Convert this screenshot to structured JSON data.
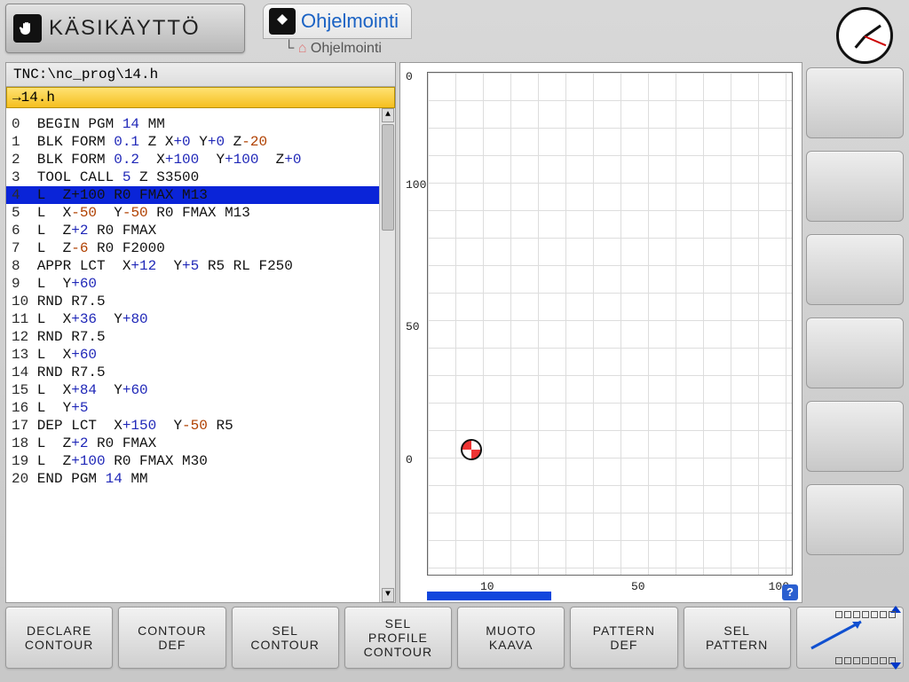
{
  "header": {
    "mode_label": "KÄSIKÄYTTÖ",
    "tab_label": "Ohjelmointi",
    "breadcrumb": "Ohjelmointi"
  },
  "editor": {
    "path": "TNC:\\nc_prog\\14.h",
    "file_tab": "→14.h",
    "selected_index": 4,
    "lines": [
      {
        "n": "0",
        "t": [
          [
            "kw",
            " BEGIN PGM "
          ],
          [
            "num",
            "14"
          ],
          [
            "kw",
            " MM"
          ]
        ]
      },
      {
        "n": "1",
        "t": [
          [
            "kw",
            " BLK FORM "
          ],
          [
            "num",
            "0.1"
          ],
          [
            "kw",
            " Z X"
          ],
          [
            "num",
            "+0"
          ],
          [
            "kw",
            " Y"
          ],
          [
            "num",
            "+0"
          ],
          [
            "kw",
            " Z"
          ],
          [
            "neg",
            "-20"
          ]
        ]
      },
      {
        "n": "2",
        "t": [
          [
            "kw",
            " BLK FORM "
          ],
          [
            "num",
            "0.2"
          ],
          [
            "kw",
            "  X"
          ],
          [
            "num",
            "+100"
          ],
          [
            "kw",
            "  Y"
          ],
          [
            "num",
            "+100"
          ],
          [
            "kw",
            "  Z"
          ],
          [
            "num",
            "+0"
          ]
        ]
      },
      {
        "n": "3",
        "t": [
          [
            "kw",
            " TOOL CALL "
          ],
          [
            "num",
            "5"
          ],
          [
            "kw",
            " Z S3500"
          ]
        ]
      },
      {
        "n": "4",
        "t": [
          [
            "kw",
            " L  Z+100 R0 FMAX M13"
          ]
        ]
      },
      {
        "n": "5",
        "t": [
          [
            "kw",
            " L  X"
          ],
          [
            "neg",
            "-50"
          ],
          [
            "kw",
            "  Y"
          ],
          [
            "neg",
            "-50"
          ],
          [
            "kw",
            " R0 FMAX M13"
          ]
        ]
      },
      {
        "n": "6",
        "t": [
          [
            "kw",
            " L  Z"
          ],
          [
            "num",
            "+2"
          ],
          [
            "kw",
            " R0 FMAX"
          ]
        ]
      },
      {
        "n": "7",
        "t": [
          [
            "kw",
            " L  Z"
          ],
          [
            "neg",
            "-6"
          ],
          [
            "kw",
            " R0 F2000"
          ]
        ]
      },
      {
        "n": "8",
        "t": [
          [
            "kw",
            " APPR LCT  X"
          ],
          [
            "num",
            "+12"
          ],
          [
            "kw",
            "  Y"
          ],
          [
            "num",
            "+5"
          ],
          [
            "kw",
            " R5 RL F250"
          ]
        ]
      },
      {
        "n": "9",
        "t": [
          [
            "kw",
            " L  Y"
          ],
          [
            "num",
            "+60"
          ]
        ]
      },
      {
        "n": "10",
        "t": [
          [
            "kw",
            " RND R7.5"
          ]
        ]
      },
      {
        "n": "11",
        "t": [
          [
            "kw",
            " L  X"
          ],
          [
            "num",
            "+36"
          ],
          [
            "kw",
            "  Y"
          ],
          [
            "num",
            "+80"
          ]
        ]
      },
      {
        "n": "12",
        "t": [
          [
            "kw",
            " RND R7.5"
          ]
        ]
      },
      {
        "n": "13",
        "t": [
          [
            "kw",
            " L  X"
          ],
          [
            "num",
            "+60"
          ]
        ]
      },
      {
        "n": "14",
        "t": [
          [
            "kw",
            " RND R7.5"
          ]
        ]
      },
      {
        "n": "15",
        "t": [
          [
            "kw",
            " L  X"
          ],
          [
            "num",
            "+84"
          ],
          [
            "kw",
            "  Y"
          ],
          [
            "num",
            "+60"
          ]
        ]
      },
      {
        "n": "16",
        "t": [
          [
            "kw",
            " L  Y"
          ],
          [
            "num",
            "+5"
          ]
        ]
      },
      {
        "n": "17",
        "t": [
          [
            "kw",
            " DEP LCT  X"
          ],
          [
            "num",
            "+150"
          ],
          [
            "kw",
            "  Y"
          ],
          [
            "neg",
            "-50"
          ],
          [
            "kw",
            " R5"
          ]
        ]
      },
      {
        "n": "18",
        "t": [
          [
            "kw",
            " L  Z"
          ],
          [
            "num",
            "+2"
          ],
          [
            "kw",
            " R0 FMAX"
          ]
        ]
      },
      {
        "n": "19",
        "t": [
          [
            "kw",
            " L  Z"
          ],
          [
            "num",
            "+100"
          ],
          [
            "kw",
            " R0 FMAX M30"
          ]
        ]
      },
      {
        "n": "20",
        "t": [
          [
            "kw",
            " END PGM "
          ],
          [
            "num",
            "14"
          ],
          [
            "kw",
            " MM"
          ]
        ]
      }
    ]
  },
  "graphic": {
    "y_ticks": [
      "0",
      "100",
      "50",
      "0"
    ],
    "x_ticks": [
      "10",
      "50",
      "100"
    ]
  },
  "softkeys": {
    "bottom": [
      {
        "l1": "DECLARE",
        "l2": "CONTOUR"
      },
      {
        "l1": "CONTOUR",
        "l2": "DEF"
      },
      {
        "l1": "SEL",
        "l2": "CONTOUR"
      },
      {
        "l1": "SEL",
        "l2": "PROFILE",
        "l3": "CONTOUR"
      },
      {
        "l1": "MUOTO",
        "l2": "KAAVA"
      },
      {
        "l1": "PATTERN",
        "l2": "DEF"
      },
      {
        "l1": "SEL",
        "l2": "PATTERN"
      }
    ]
  }
}
